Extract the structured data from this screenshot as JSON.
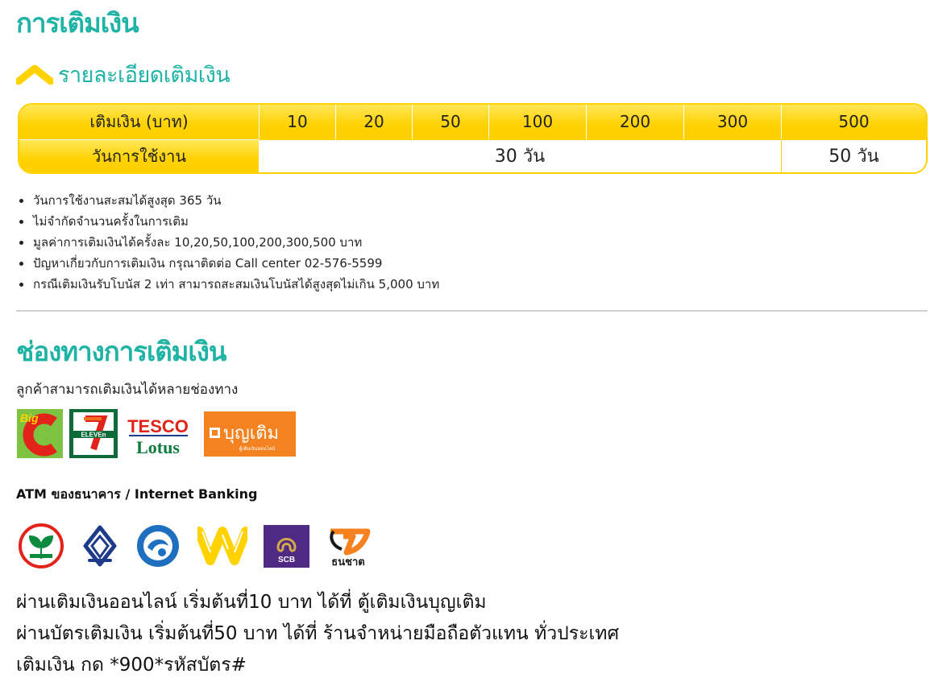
{
  "page_title": "การเติมเงิน",
  "subheading": "รายละเอียดเติมเงิน",
  "table": {
    "header_label": "เติมเงิน (บาท)",
    "amounts": [
      "10",
      "20",
      "50",
      "100",
      "200",
      "300",
      "500"
    ],
    "days_label": "วันการใช้งาน",
    "days_short": "30 วัน",
    "days_long": "50 วัน"
  },
  "notes": [
    "วันการใช้งานสะสมได้สูงสุด 365 วัน",
    "ไม่จำกัดจำนวนครั้งในการเติม",
    "มูลค่าการเติมเงินได้ครั้งละ 10,20,50,100,200,300,500 บาท",
    "ปัญหาเกี่ยวกับการเติมเงิน กรุณาติดต่อ Call center 02-576-5599",
    "กรณีเติมเงินรับโบนัส 2 เท่า สามารถสะสมเงินโบนัสได้สูงสุดไม่เกิน 5,000 บาท"
  ],
  "channels": {
    "title": "ช่องทางการเติมเงิน",
    "intro": "ลูกค้าสามารถเติมเงินได้หลายช่องทาง",
    "stores": {
      "bigc": "Big",
      "seven": "ELEVEn",
      "tesco": "TESCO",
      "lotus": "Lotus",
      "boonterm": "บุญเติม",
      "boonterm_sub": "ตู้เติมเงินออนไลน์"
    },
    "atm_label": "ATM ของธนาคาร / Internet Banking",
    "banks": {
      "scb": "SCB",
      "thanachart": "ธนชาต"
    }
  },
  "bottom_lines": [
    "ผ่านเติมเงินออนไลน์ เริ่มต้นที่10 บาท ได้ที่ ตู้เติมเงินบุญเติม",
    "ผ่านบัตรเติมเงิน เริ่มต้นที่50 บาท ได้ที่ ร้านจำหน่ายมือถือตัวแทน ทั่วประเทศ",
    "เติมเงิน กด *900*รหัสบัตร#"
  ],
  "colors": {
    "teal": "#1eb3a5",
    "yellow": "#ffd200"
  }
}
